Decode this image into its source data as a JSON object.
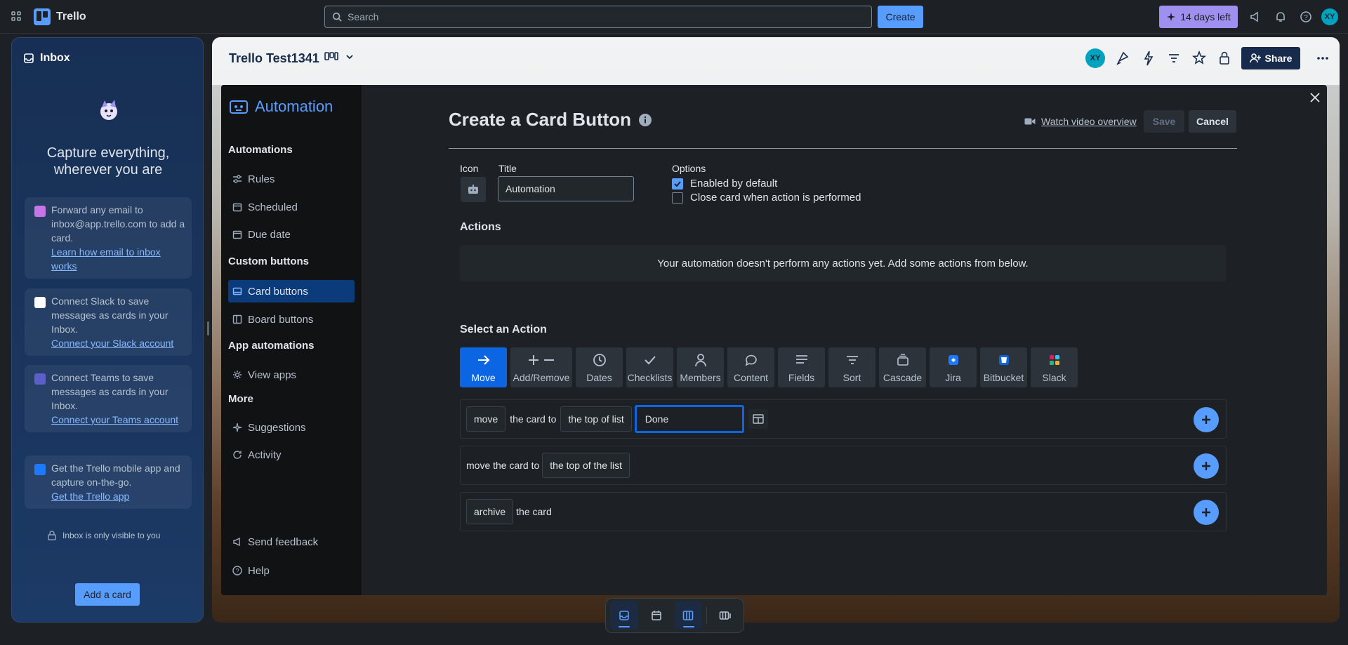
{
  "topbar": {
    "app_name": "Trello",
    "search_placeholder": "Search",
    "create_label": "Create",
    "trial_label": "14 days left",
    "avatar_initials": "XY"
  },
  "inbox": {
    "title": "Inbox",
    "headline": "Capture everything, wherever you are",
    "cards": [
      {
        "text": "Forward any email to inbox@app.trello.com to add a card.",
        "link": "Learn how email to inbox works",
        "icon": "email-icon"
      },
      {
        "text": "Connect Slack to save messages as cards in your Inbox.",
        "link": "Connect your Slack account",
        "icon": "slack-icon"
      },
      {
        "text": "Connect Teams to save messages as cards in your Inbox.",
        "link": "Connect your Teams account",
        "icon": "teams-icon"
      },
      {
        "text": "Get the Trello mobile app and capture on-the-go.",
        "link": "Get the Trello app",
        "icon": "mobile-icon"
      }
    ],
    "private_note": "Inbox is only visible to you",
    "add_card_label": "Add a card"
  },
  "board": {
    "title": "Trello Test1341",
    "share_label": "Share",
    "member_initials": "XY"
  },
  "automation": {
    "title": "Automation",
    "sections": {
      "automations": "Automations",
      "custom_buttons": "Custom buttons",
      "app_automations": "App automations",
      "more": "More"
    },
    "items": {
      "rules": "Rules",
      "scheduled": "Scheduled",
      "due_date": "Due date",
      "card_buttons": "Card buttons",
      "board_buttons": "Board buttons",
      "view_apps": "View apps",
      "suggestions": "Suggestions",
      "activity": "Activity",
      "send_feedback": "Send feedback",
      "help": "Help"
    }
  },
  "editor": {
    "heading": "Create a Card Button",
    "watch_label": "Watch video overview",
    "save_label": "Save",
    "cancel_label": "Cancel",
    "icon_label": "Icon",
    "title_label": "Title",
    "title_value": "Automation",
    "options_label": "Options",
    "option_enabled": "Enabled by default",
    "option_enabled_checked": true,
    "option_close": "Close card when action is performed",
    "option_close_checked": false,
    "actions_heading": "Actions",
    "actions_empty": "Your automation doesn't perform any actions yet. Add some actions from below.",
    "select_heading": "Select an Action",
    "action_tabs": [
      "Move",
      "Add/Remove",
      "Dates",
      "Checklists",
      "Members",
      "Content",
      "Fields",
      "Sort",
      "Cascade",
      "Jira",
      "Bitbucket",
      "Slack"
    ],
    "active_tab": "Move",
    "row1": {
      "verb": "move",
      "mid": "the card to",
      "position": "the top of list",
      "list_value": "Done"
    },
    "row2": {
      "text": "move the card to",
      "position": "the top of the list"
    },
    "row3": {
      "verb": "archive",
      "rest": "the card"
    }
  },
  "colors": {
    "accent": "#579dff",
    "active_tab": "#0c66e4",
    "trial": "#9f8fef"
  }
}
